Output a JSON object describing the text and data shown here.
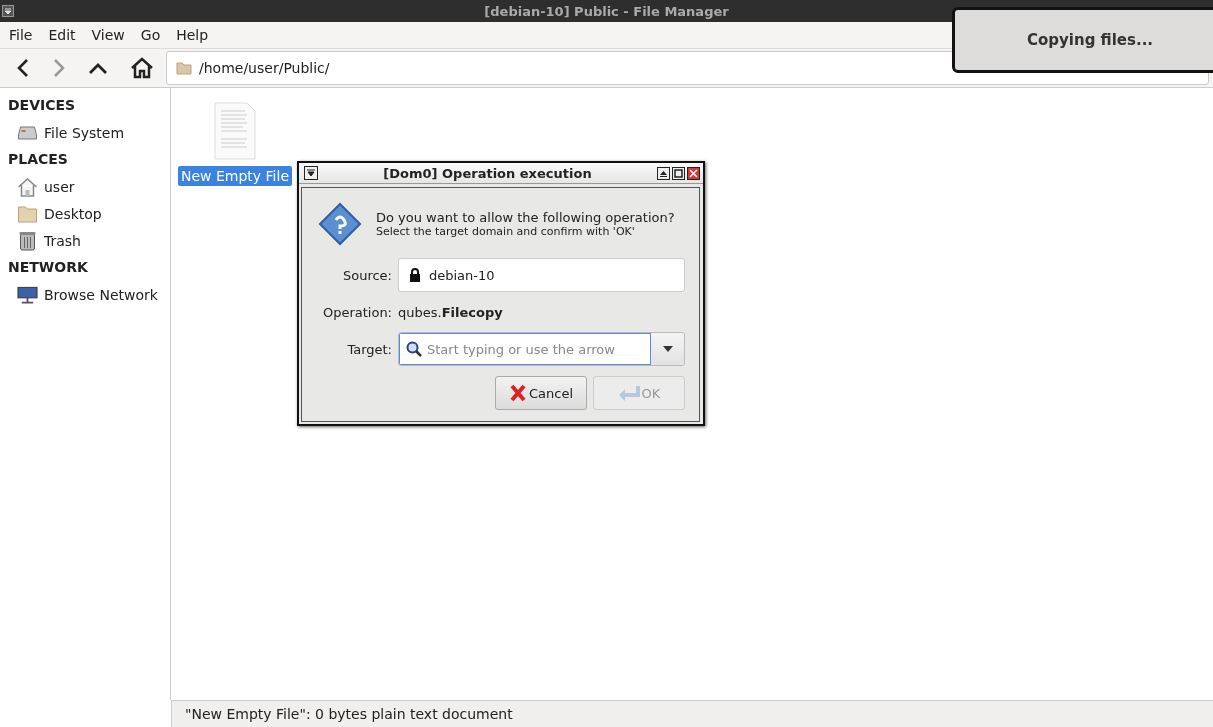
{
  "window": {
    "title": "[debian-10] Public - File Manager"
  },
  "menu": [
    "File",
    "Edit",
    "View",
    "Go",
    "Help"
  ],
  "location": {
    "value": "/home/user/Public/"
  },
  "sidebar": [
    {
      "heading": "DEVICES",
      "items": [
        {
          "label": "File System",
          "kind": "drive"
        }
      ]
    },
    {
      "heading": "PLACES",
      "items": [
        {
          "label": "user",
          "kind": "home"
        },
        {
          "label": "Desktop",
          "kind": "folder"
        },
        {
          "label": "Trash",
          "kind": "trash"
        }
      ]
    },
    {
      "heading": "NETWORK",
      "items": [
        {
          "label": "Browse Network",
          "kind": "network"
        }
      ]
    }
  ],
  "files": [
    {
      "name": "New Empty File",
      "selected": true
    }
  ],
  "status_bar": "\"New Empty File\": 0 bytes plain text document",
  "dialog": {
    "title": "[Dom0] Operation execution",
    "question": "Do you want to allow the following operation?",
    "hint": "Select the target domain and confirm with 'OK'",
    "source_label": "Source:",
    "source": "debian-10",
    "operation_label": "Operation:",
    "operation": "qubes.**Filecopy**",
    "target_label": "Target:",
    "target_placeholder": "Start typing or use the arrow",
    "buttons": [
      {
        "label": "Cancel",
        "kind": "cancel",
        "disabled": false
      },
      {
        "label": "OK",
        "kind": "ok",
        "disabled": true
      }
    ]
  },
  "notification": {
    "text": "Copying files..."
  }
}
